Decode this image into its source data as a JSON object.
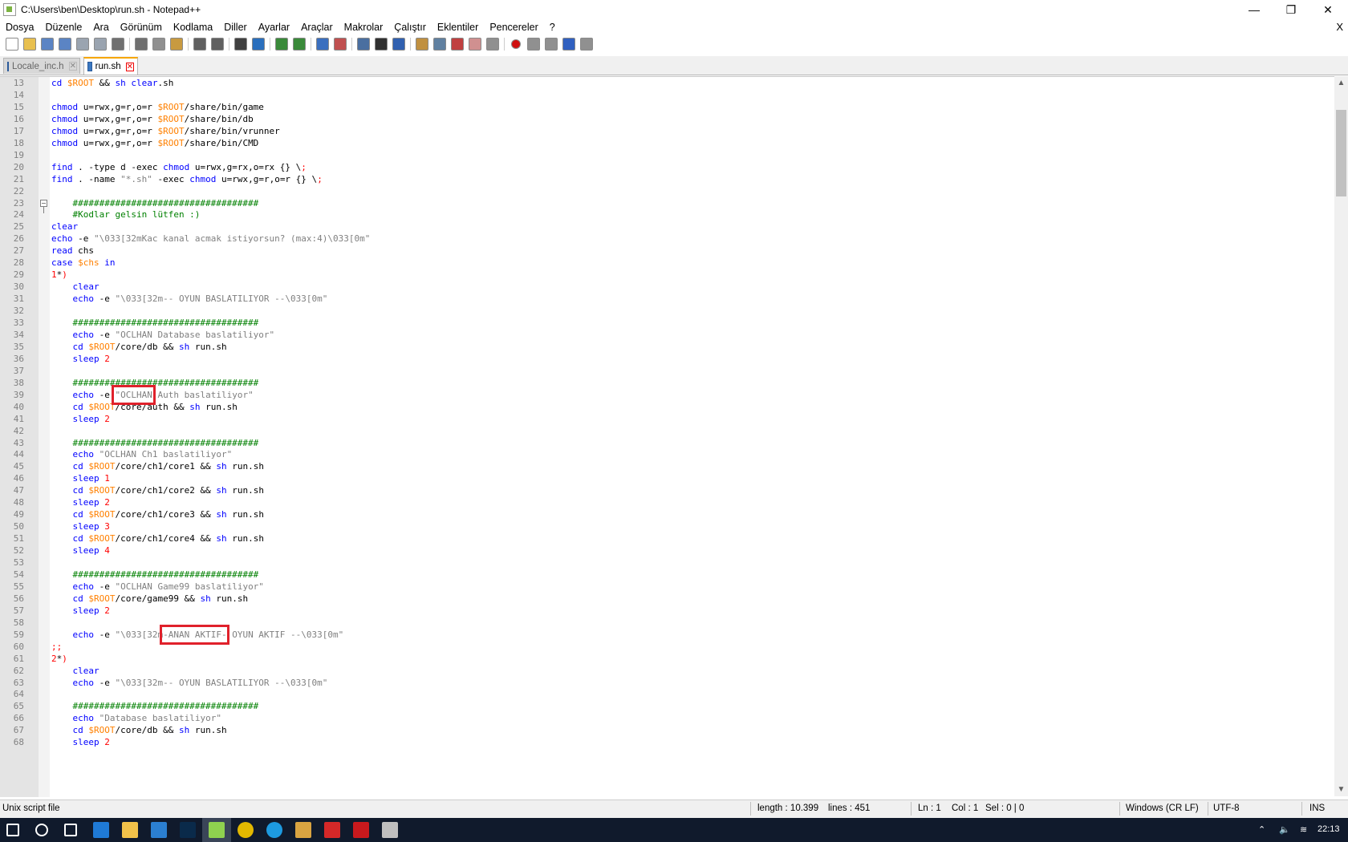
{
  "window": {
    "title": "C:\\Users\\ben\\Desktop\\run.sh - Notepad++",
    "minimize_glyph": "—",
    "maximize_glyph": "❐",
    "close_glyph": "✕",
    "menu_close_glyph": "X"
  },
  "menu": {
    "items": [
      "Dosya",
      "Düzenle",
      "Ara",
      "Görünüm",
      "Kodlama",
      "Diller",
      "Ayarlar",
      "Araçlar",
      "Makrolar",
      "Çalıştır",
      "Eklentiler",
      "Pencereler",
      "?"
    ]
  },
  "toolbar": {
    "icons": [
      "new-file-icon",
      "open-file-icon",
      "save-icon",
      "save-all-icon",
      "close-file-icon",
      "close-all-icon",
      "print-icon",
      "cut-icon",
      "copy-icon",
      "paste-icon",
      "undo-icon",
      "redo-icon",
      "find-icon",
      "replace-icon",
      "zoom-in-icon",
      "zoom-out-icon",
      "sync-vertical-icon",
      "sync-horizontal-icon",
      "word-wrap-icon",
      "show-all-chars-icon",
      "indent-guide-icon",
      "udl-icon",
      "doc-map-icon",
      "function-list-icon",
      "folder-workspace-icon",
      "monitoring-icon",
      "record-macro-icon",
      "stop-record-icon",
      "play-macro-icon",
      "run-macro-multiple-icon",
      "save-macro-icon"
    ]
  },
  "tabs": [
    {
      "label": "Locale_inc.h",
      "active": false
    },
    {
      "label": "run.sh",
      "active": true
    }
  ],
  "editor": {
    "lines": [
      {
        "n": "13",
        "t": "cd $ROOT && sh clear.sh"
      },
      {
        "n": "14",
        "t": ""
      },
      {
        "n": "15",
        "t": "chmod u=rwx,g=r,o=r $ROOT/share/bin/game"
      },
      {
        "n": "16",
        "t": "chmod u=rwx,g=r,o=r $ROOT/share/bin/db"
      },
      {
        "n": "17",
        "t": "chmod u=rwx,g=r,o=r $ROOT/share/bin/vrunner"
      },
      {
        "n": "18",
        "t": "chmod u=rwx,g=r,o=r $ROOT/share/bin/CMD"
      },
      {
        "n": "19",
        "t": ""
      },
      {
        "n": "20",
        "t": "find . -type d -exec chmod u=rwx,g=rx,o=rx {} \\;"
      },
      {
        "n": "21",
        "t": "find . -name \"*.sh\" -exec chmod u=rwx,g=r,o=r {} \\;"
      },
      {
        "n": "22",
        "t": ""
      },
      {
        "n": "23",
        "t": "    ###################################"
      },
      {
        "n": "24",
        "t": "    #Kodlar gelsin lütfen :)"
      },
      {
        "n": "25",
        "t": "clear"
      },
      {
        "n": "26",
        "t": "echo -e \"\\033[32mKac kanal acmak istiyorsun? (max:4)\\033[0m\""
      },
      {
        "n": "27",
        "t": "read chs"
      },
      {
        "n": "28",
        "t": "case $chs in"
      },
      {
        "n": "29",
        "t": "1*)"
      },
      {
        "n": "30",
        "t": "    clear"
      },
      {
        "n": "31",
        "t": "    echo -e \"\\033[32m-- OYUN BASLATILIYOR --\\033[0m\""
      },
      {
        "n": "32",
        "t": ""
      },
      {
        "n": "33",
        "t": "    ###################################"
      },
      {
        "n": "34",
        "t": "    echo -e \"OCLHAN Database baslatiliyor\""
      },
      {
        "n": "35",
        "t": "    cd $ROOT/core/db && sh run.sh"
      },
      {
        "n": "36",
        "t": "    sleep 2"
      },
      {
        "n": "37",
        "t": ""
      },
      {
        "n": "38",
        "t": "    ###################################"
      },
      {
        "n": "39",
        "t": "    echo -e \"OCLHAN Auth baslatiliyor\""
      },
      {
        "n": "40",
        "t": "    cd $ROOT/core/auth && sh run.sh"
      },
      {
        "n": "41",
        "t": "    sleep 2"
      },
      {
        "n": "42",
        "t": ""
      },
      {
        "n": "43",
        "t": "    ###################################"
      },
      {
        "n": "44",
        "t": "    echo \"OCLHAN Ch1 baslatiliyor\""
      },
      {
        "n": "45",
        "t": "    cd $ROOT/core/ch1/core1 && sh run.sh"
      },
      {
        "n": "46",
        "t": "    sleep 1"
      },
      {
        "n": "47",
        "t": "    cd $ROOT/core/ch1/core2 && sh run.sh"
      },
      {
        "n": "48",
        "t": "    sleep 2"
      },
      {
        "n": "49",
        "t": "    cd $ROOT/core/ch1/core3 && sh run.sh"
      },
      {
        "n": "50",
        "t": "    sleep 3"
      },
      {
        "n": "51",
        "t": "    cd $ROOT/core/ch1/core4 && sh run.sh"
      },
      {
        "n": "52",
        "t": "    sleep 4"
      },
      {
        "n": "53",
        "t": ""
      },
      {
        "n": "54",
        "t": "    ###################################"
      },
      {
        "n": "55",
        "t": "    echo -e \"OCLHAN Game99 baslatiliyor\""
      },
      {
        "n": "56",
        "t": "    cd $ROOT/core/game99 && sh run.sh"
      },
      {
        "n": "57",
        "t": "    sleep 2"
      },
      {
        "n": "58",
        "t": ""
      },
      {
        "n": "59",
        "t": "    echo -e \"\\033[32m-ANAN AKTIF- OYUN AKTIF --\\033[0m\""
      },
      {
        "n": "60",
        "t": ";;"
      },
      {
        "n": "61",
        "t": "2*)"
      },
      {
        "n": "62",
        "t": "    clear"
      },
      {
        "n": "63",
        "t": "    echo -e \"\\033[32m-- OYUN BASLATILIYOR --\\033[0m\""
      },
      {
        "n": "64",
        "t": ""
      },
      {
        "n": "65",
        "t": "    ###################################"
      },
      {
        "n": "66",
        "t": "    echo \"Database baslatiliyor\""
      },
      {
        "n": "67",
        "t": "    cd $ROOT/core/db && sh run.sh"
      },
      {
        "n": "68",
        "t": "    sleep 2"
      }
    ]
  },
  "status": {
    "file_type": "Unix script file",
    "length": "length : 10.399",
    "lines": "lines : 451",
    "ln": "Ln : 1",
    "col": "Col : 1",
    "sel": "Sel : 0 | 0",
    "eol": "Windows (CR LF)",
    "encoding": "UTF-8",
    "mode": "INS"
  },
  "taskbar": {
    "apps": [
      "windows-start-icon",
      "search-icon",
      "task-view-icon",
      "edge-icon",
      "file-explorer-icon",
      "media-app-icon",
      "photoshop-icon",
      "notepadpp-icon",
      "chrome-icon",
      "skype-icon",
      "paint-icon",
      "acrobat-icon",
      "filezilla-icon",
      "network-tool-icon"
    ],
    "clock": "22:13"
  },
  "colors": {
    "keyword": "#0000ff",
    "variable": "#ff8000",
    "string": "#808080",
    "comment": "#008000",
    "number": "#ff0000",
    "highlight_box": "#e0212b"
  }
}
